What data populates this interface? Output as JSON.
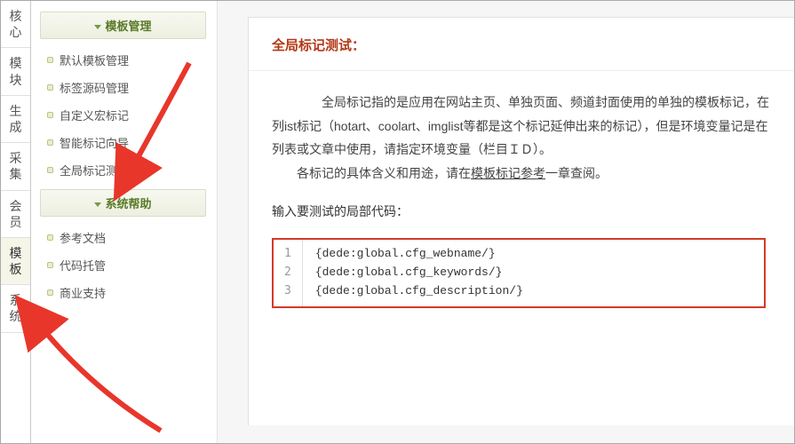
{
  "vtabs": [
    "核心",
    "模块",
    "生成",
    "采集",
    "会员",
    "模板",
    "系统"
  ],
  "vtab_active_index": 5,
  "sidebar": {
    "groups": [
      {
        "title": "模板管理",
        "items": [
          "默认模板管理",
          "标签源码管理",
          "自定义宏标记",
          "智能标记向导",
          "全局标记测试"
        ]
      },
      {
        "title": "系统帮助",
        "items": [
          "参考文档",
          "代码托管",
          "商业支持"
        ]
      }
    ]
  },
  "content": {
    "title": "全局标记测试：",
    "paragraph1": "　　全局标记指的是应用在网站主页、单独页面、频道封面使用的单独的模板标记，在列ist标记（hotart、coolart、imglist等都是这个标记延伸出来的标记），但是环境变量记是在列表或文章中使用，请指定环境变量（栏目ＩＤ）。",
    "paragraph2_prefix": "　　各标记的具体含义和用途，请在",
    "paragraph2_link": "模板标记参考",
    "paragraph2_suffix": "一章查阅。",
    "input_label": "输入要测试的局部代码：",
    "code_lines": [
      "{dede:global.cfg_webname/}",
      "{dede:global.cfg_keywords/}",
      "{dede:global.cfg_description/}"
    ]
  },
  "colors": {
    "arrow": "#e8362b",
    "code_border": "#d43a2a",
    "title": "#b43816",
    "group_header_text": "#5a7a28"
  }
}
